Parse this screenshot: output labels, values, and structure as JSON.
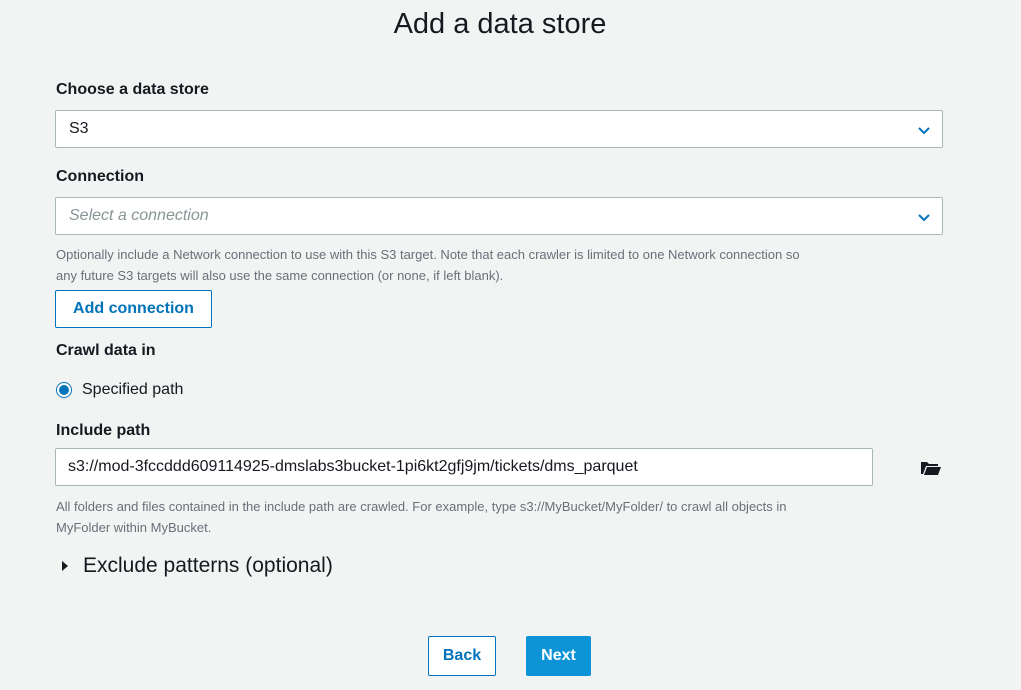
{
  "page_title": "Add a data store",
  "data_store": {
    "label": "Choose a data store",
    "selected": "S3",
    "chevron_icon": "chevron-down-icon"
  },
  "connection": {
    "label": "Connection",
    "placeholder": "Select a connection",
    "help_text_line1": "Optionally include a Network connection to use with this S3 target. Note that each crawler is limited to one Network connection so",
    "help_text_line2": "any future S3 targets will also use the same connection (or none, if left blank).",
    "add_button": "Add connection"
  },
  "crawl": {
    "label": "Crawl data in",
    "option_label": "Specified path",
    "option_checked": true
  },
  "include_path": {
    "label": "Include path",
    "value": "s3://mod-3fccddd609114925-dmslabs3bucket-1pi6kt2gfj9jm/tickets/dms_parquet",
    "browse_icon": "folder-open-icon",
    "help_text_line1": "All folders and files contained in the include path are crawled. For example, type s3://MyBucket/MyFolder/ to crawl all objects in",
    "help_text_line2": "MyFolder within MyBucket."
  },
  "exclude": {
    "label": "Exclude patterns (optional)",
    "expanded": false
  },
  "footer": {
    "back_label": "Back",
    "next_label": "Next"
  },
  "colors": {
    "accent": "#0073bb",
    "primary_button": "#0d94d6",
    "background": "#f2f3f3"
  }
}
